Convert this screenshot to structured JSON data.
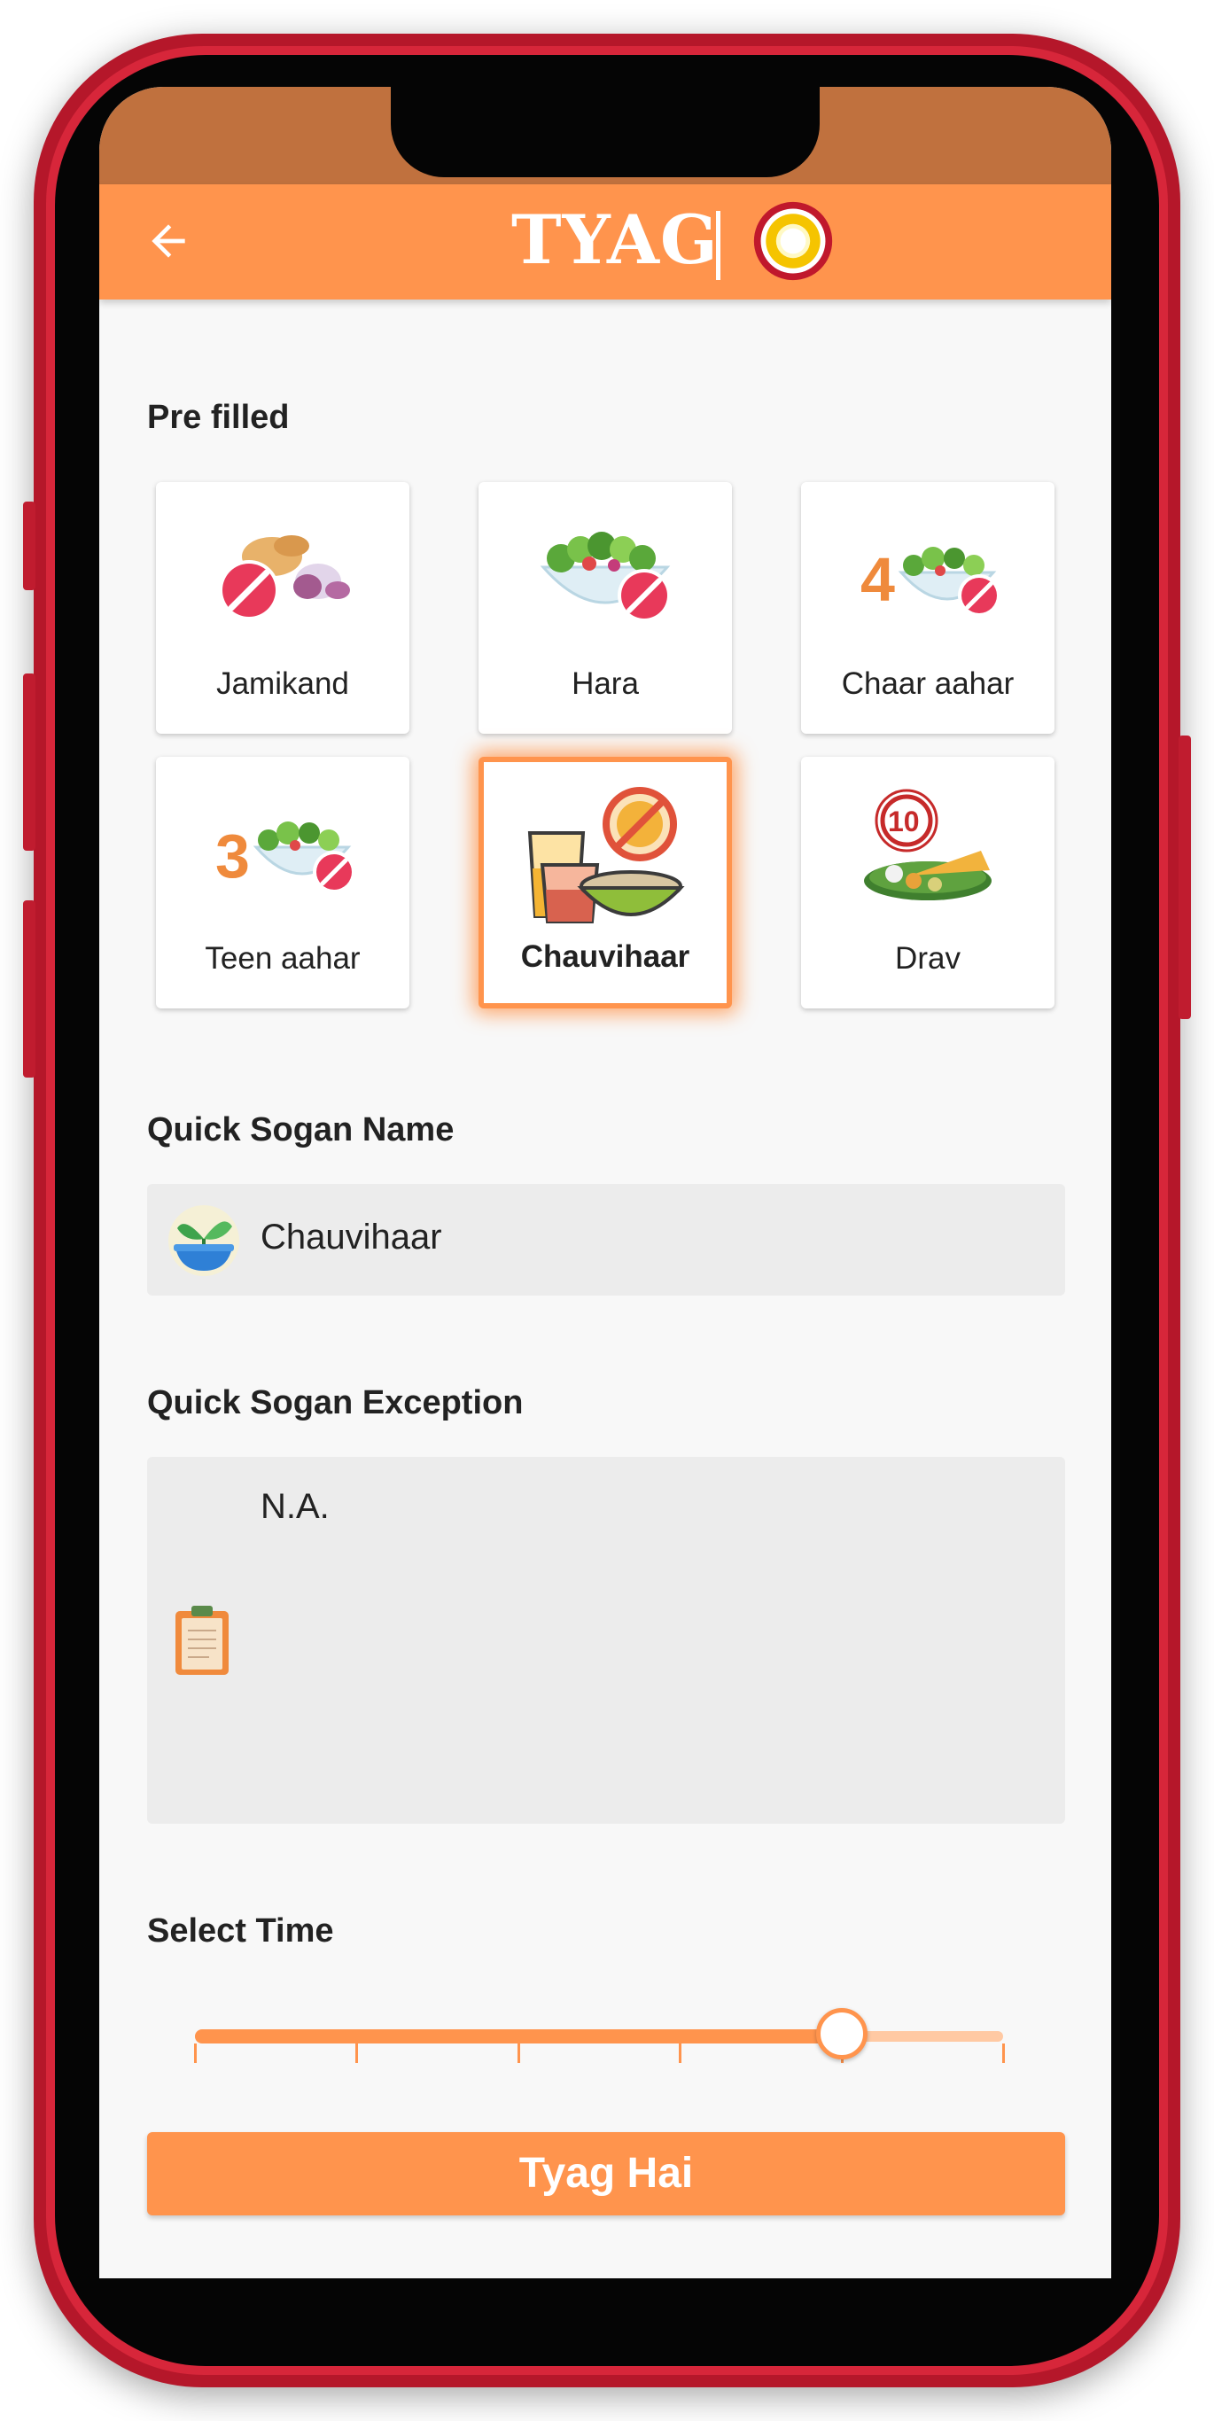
{
  "header": {
    "title": "TYAG",
    "back_icon": "arrow-left-icon",
    "logo_icon": "ring-logo-icon"
  },
  "prefilled": {
    "heading": "Pre filled",
    "items": [
      {
        "label": "Jamikand",
        "icon": "root-vegetables-prohibited-icon",
        "selected": false
      },
      {
        "label": "Hara",
        "icon": "green-salad-prohibited-icon",
        "selected": false
      },
      {
        "label": "Chaar aahar",
        "icon": "four-meals-prohibited-icon",
        "selected": false
      },
      {
        "label": "Teen aahar",
        "icon": "three-meals-prohibited-icon",
        "selected": false
      },
      {
        "label": "Chauvihaar",
        "icon": "food-and-drink-after-sunset-prohibited-icon",
        "selected": true
      },
      {
        "label": "Drav",
        "icon": "ten-item-meal-icon",
        "selected": false
      }
    ]
  },
  "sogan_name": {
    "heading": "Quick Sogan Name",
    "value": "Chauvihaar",
    "icon": "sprout-bowl-icon"
  },
  "sogan_exception": {
    "heading": "Quick Sogan Exception",
    "value": "N.A.",
    "icon": "clipboard-icon"
  },
  "time": {
    "heading": "Select Time",
    "slider_fraction": 0.8,
    "steps": 5
  },
  "submit": {
    "label": "Tyag Hai"
  },
  "colors": {
    "accent": "#ff944d",
    "status_bar": "#c0713e",
    "frame": "#d7263a"
  }
}
